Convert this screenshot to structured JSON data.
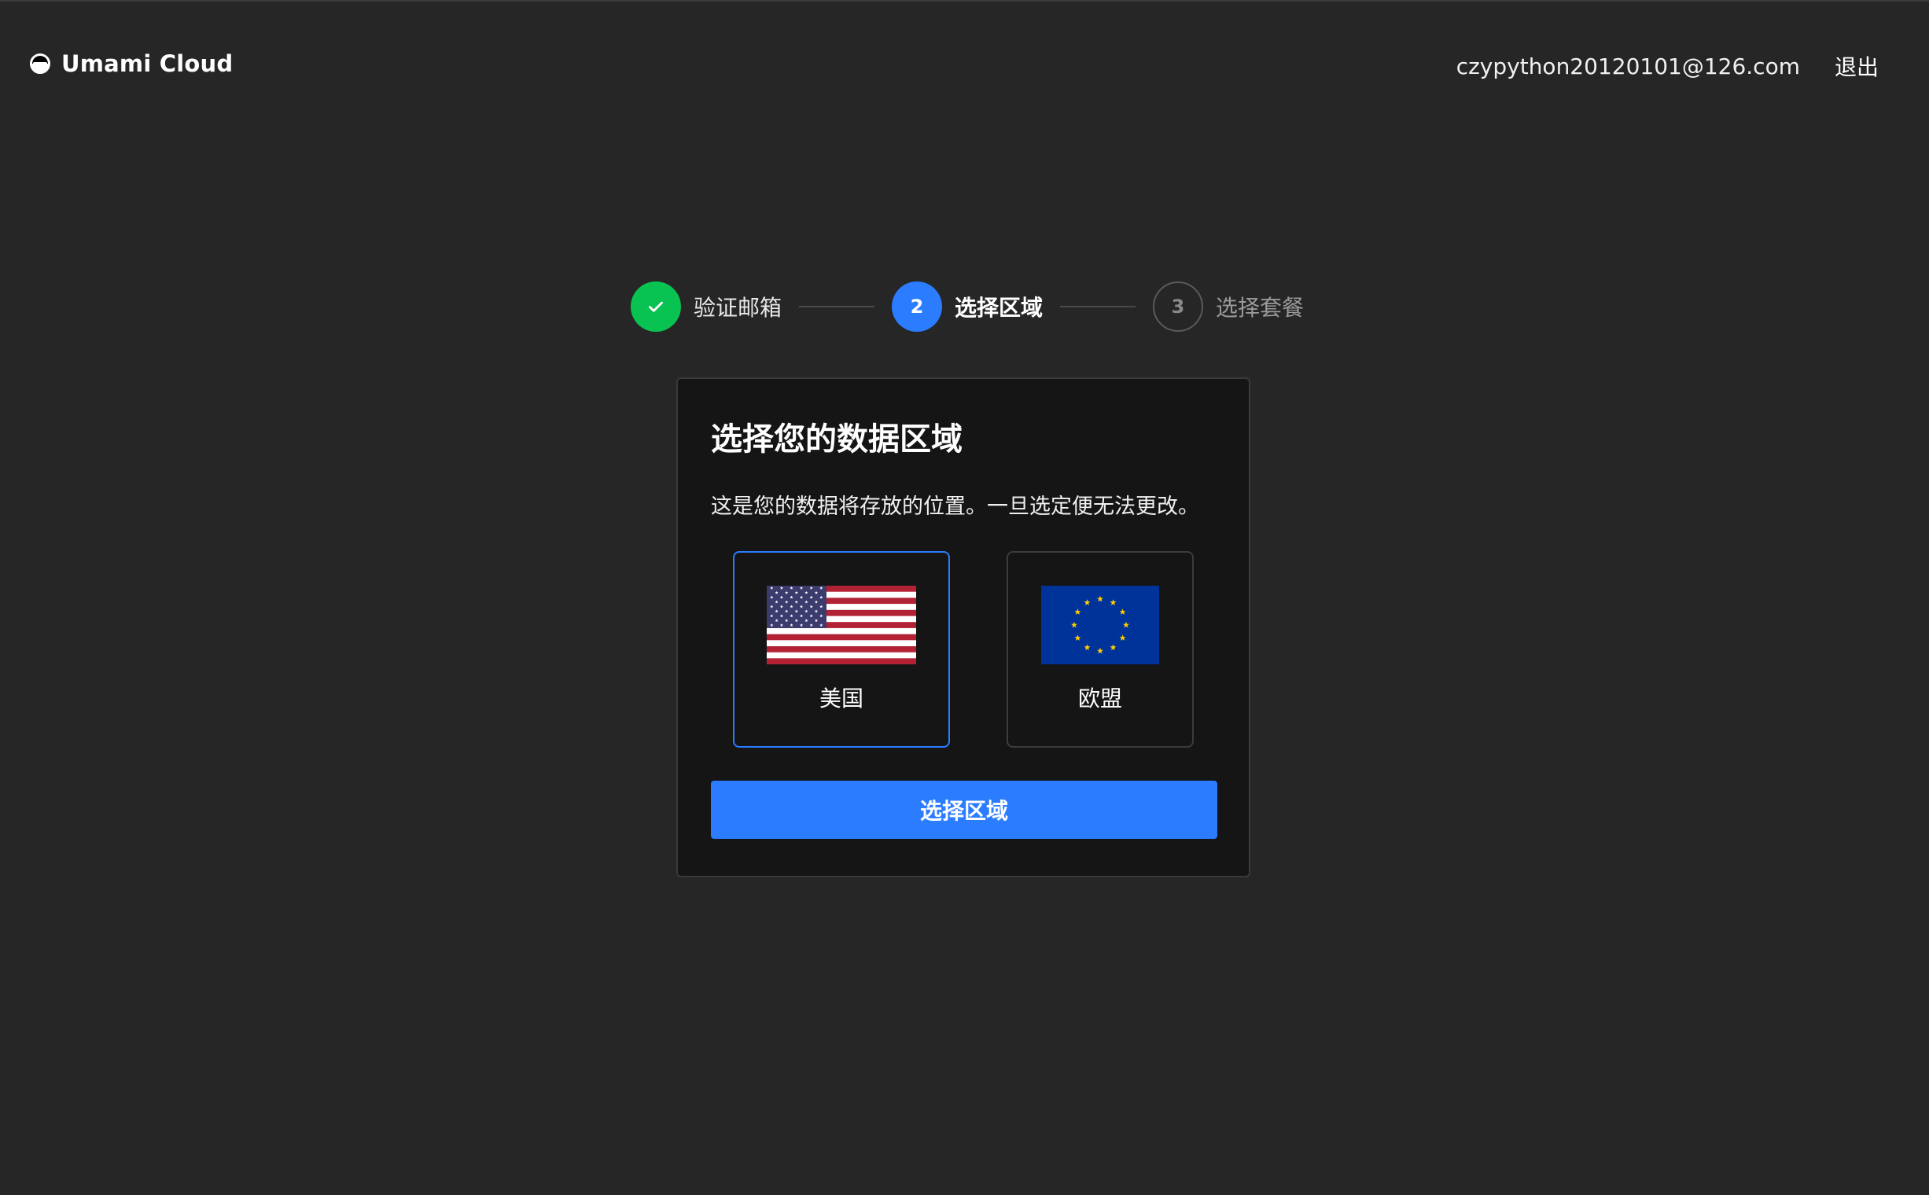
{
  "header": {
    "brand": "Umami Cloud",
    "user_email": "czypython20120101@126.com",
    "logout": "退出"
  },
  "stepper": {
    "steps": [
      {
        "label": "验证邮箱",
        "status": "done",
        "number": ""
      },
      {
        "label": "选择区域",
        "status": "active",
        "number": "2"
      },
      {
        "label": "选择套餐",
        "status": "pending",
        "number": "3"
      }
    ]
  },
  "card": {
    "title": "选择您的数据区域",
    "description": "这是您的数据将存放的位置。一旦选定便无法更改。",
    "regions": [
      {
        "label": "美国",
        "icon": "us-flag-icon",
        "selected": true
      },
      {
        "label": "欧盟",
        "icon": "eu-flag-icon",
        "selected": false
      }
    ],
    "submit_label": "选择区域"
  },
  "colors": {
    "background": "#262626",
    "card": "#151515",
    "accent": "#2b7cff",
    "success": "#08c351"
  }
}
